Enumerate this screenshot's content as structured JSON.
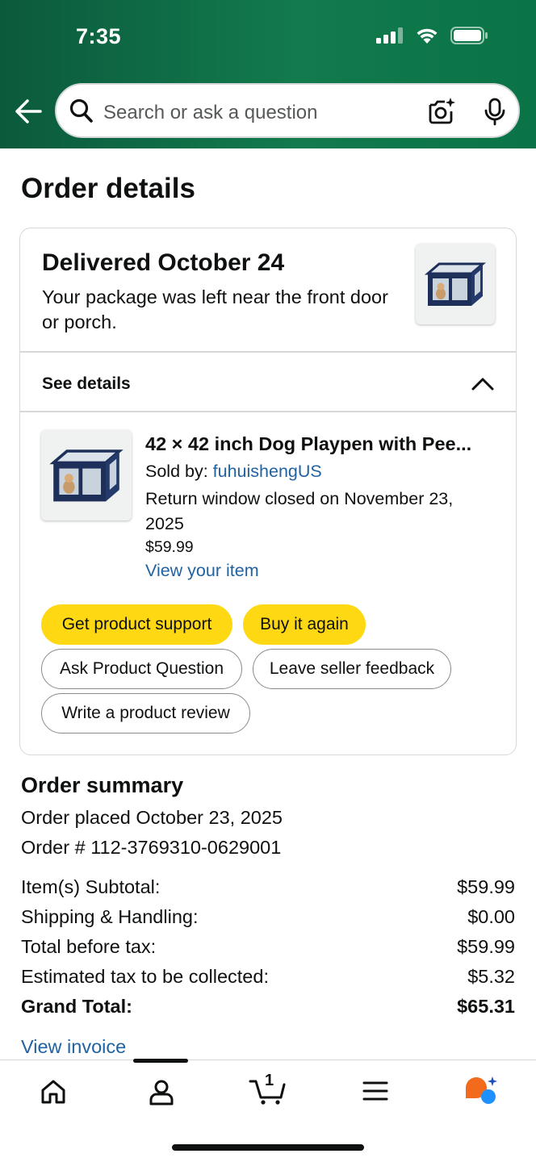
{
  "status_bar": {
    "time": "7:35",
    "icons": [
      "signal-icon",
      "wifi-icon",
      "battery-icon"
    ]
  },
  "header": {
    "back_icon": "back-arrow-icon",
    "search_placeholder": "Search or ask a question",
    "camera_icon": "camera-search-icon",
    "mic_icon": "microphone-icon",
    "colors": {
      "header_start": "#0b5a3c",
      "header_end": "#0a7447"
    }
  },
  "page": {
    "title": "Order details"
  },
  "delivery": {
    "title": "Delivered October 24",
    "message": "Your package was left near the front door or porch.",
    "see_details_label": "See details"
  },
  "item": {
    "title": "42 × 42 inch Dog Playpen with Pee...",
    "sold_by_label": "Sold by: ",
    "seller": "fuhuishengUS",
    "return_window": "Return window closed on November 23, 2025",
    "price": "$59.99",
    "view_item_label": "View your item"
  },
  "actions": {
    "get_support": "Get product support",
    "buy_again": "Buy it again",
    "ask_question": "Ask Product Question",
    "seller_feedback": "Leave seller feedback",
    "write_review": "Write a product review",
    "colors": {
      "primary": "#ffd814",
      "outline": "#888c8c"
    }
  },
  "summary": {
    "title": "Order summary",
    "order_placed": "Order placed October 23, 2025",
    "order_number": "Order # 112-3769310-0629001",
    "rows": [
      {
        "label": "Item(s) Subtotal:",
        "value": "$59.99"
      },
      {
        "label": "Shipping & Handling:",
        "value": "$0.00"
      },
      {
        "label": "Total before tax:",
        "value": "$59.99"
      },
      {
        "label": "Estimated tax to be collected:",
        "value": "$5.32"
      },
      {
        "label": "Grand Total:",
        "value": "$65.31"
      }
    ],
    "view_invoice_label": "View invoice"
  },
  "bottom_nav": {
    "items": [
      "home-icon",
      "account-icon",
      "cart-icon",
      "menu-icon",
      "rufus-icon"
    ],
    "cart_count": "1",
    "link_color": "#2162a1"
  }
}
